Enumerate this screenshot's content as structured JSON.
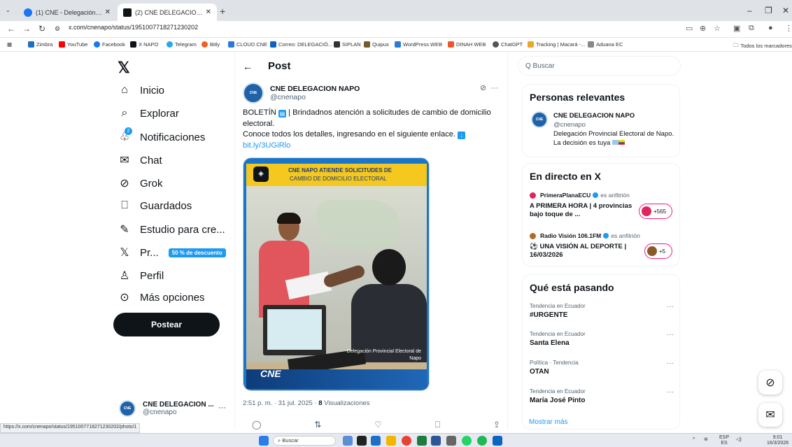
{
  "browser": {
    "tabs": [
      {
        "title": "(1) CNE - Delegación Provincial",
        "fav_color": "#1877f2"
      },
      {
        "title": "(2) CNE DELEGACION NAPO en",
        "fav_color": "#0f1419"
      }
    ],
    "url": "x.com/cnenapo/status/1951007718271230202",
    "bookmarks": [
      {
        "label": "Zimbra",
        "color": "#1f6fc5"
      },
      {
        "label": "YouTube",
        "color": "#ff0000"
      },
      {
        "label": "Facebook",
        "color": "#1877f2"
      },
      {
        "label": "X NAPO",
        "color": "#0f1419"
      },
      {
        "label": "Telegram",
        "color": "#27a7e7"
      },
      {
        "label": "Bitly",
        "color": "#ee6123"
      },
      {
        "label": "CLOUD CNE",
        "color": "#2a7ad8"
      },
      {
        "label": "Correo: DELEGACIÓ...",
        "color": "#0a64c2"
      },
      {
        "label": "SIPLAN",
        "color": "#333"
      },
      {
        "label": "Quipux",
        "color": "#7a5a2a"
      },
      {
        "label": "WordPress WEB",
        "color": "#2a7ad8"
      },
      {
        "label": "DINAH WEB",
        "color": "#e8582b"
      },
      {
        "label": "ChatGPT",
        "color": "#555"
      },
      {
        "label": "Tracking | Macará -...",
        "color": "#e8a92b"
      },
      {
        "label": "Aduana EC",
        "color": "#888"
      }
    ],
    "all_bookmarks": "Todos los marcadores"
  },
  "nav": {
    "items": [
      {
        "label": "Inicio",
        "icon": "⌂"
      },
      {
        "label": "Explorar",
        "icon": "⌕"
      },
      {
        "label": "Notificaciones",
        "icon": "🔔"
      },
      {
        "label": "Chat",
        "icon": "✉"
      },
      {
        "label": "Grok",
        "icon": "⊘"
      },
      {
        "label": "Guardados",
        "icon": "⎕"
      },
      {
        "label": "Estudio para cre...",
        "icon": "✎"
      },
      {
        "label": "Pr...",
        "icon": "𝕏"
      },
      {
        "label": "Perfil",
        "icon": "♙"
      },
      {
        "label": "Más opciones",
        "icon": "⊙"
      }
    ],
    "discount_badge": "50 % de descuento",
    "notif_count": "2",
    "post_button": "Postear"
  },
  "account": {
    "name": "CNE DELEGACION ...",
    "handle": "@cnenapo"
  },
  "post": {
    "header": "Post",
    "author_name": "CNE DELEGACION NAPO",
    "author_handle": "@cnenapo",
    "text_line1": "BOLETÍN",
    "text_line1_rest": "| Brindadnos atención a solicitudes de cambio de domicilio electoral.",
    "text_line2": "Conoce todos los detalles, ingresando en el siguiente enlace.",
    "link": "bit.ly/3UGiRlo",
    "media": {
      "banner_l1": "CNE NAPO ATIENDE SOLICITUDES DE",
      "banner_l2": "CAMBIO DE DOMICILIO ELECTORAL",
      "logo": "CNE",
      "footer_text": "Delegación Provincial Electoral de Napo"
    },
    "time": "2:51 p. m. · 31 jul. 2025 ·",
    "views_count": "8",
    "views_label": "Visualizaciones"
  },
  "sidebar": {
    "search_placeholder": "Q Buscar",
    "relevant": {
      "title": "Personas relevantes",
      "name": "CNE DELEGACION NAPO",
      "handle": "@cnenapo",
      "bio": "Delegación Provincial Electoral de Napo. La decisión es tuya"
    },
    "live": {
      "title": "En directo en X",
      "items": [
        {
          "host": "PrimeraPlanaECU",
          "suffix": "es anfitrión",
          "title": "A PRIMERA HORA | 4 provincias bajo toque de ...",
          "count": "+565",
          "dot": "#e0245e"
        },
        {
          "host": "Radio Visión 106.1FM",
          "suffix": "es anfitrión",
          "title": "⚽ UNA VISIÓN AL DEPORTE | 16/03/2026",
          "count": "+5",
          "dot": "#b36b2a"
        }
      ]
    },
    "trends": {
      "title": "Qué está pasando",
      "items": [
        {
          "context": "Tendencia en Ecuador",
          "name": "#URGENTE"
        },
        {
          "context": "Tendencia en Ecuador",
          "name": "Santa Elena"
        },
        {
          "context": "Política · Tendencia",
          "name": "OTAN"
        },
        {
          "context": "Tendencia en Ecuador",
          "name": "María José Pinto"
        }
      ],
      "show_more": "Mostrar más"
    }
  },
  "status_url": "https://x.com/cnenapo/status/1951007718271230202/photo/1",
  "taskbar": {
    "search": "Buscar",
    "lang1": "ESP",
    "lang2": "ES",
    "time": "9:01",
    "date": "16/3/2026"
  }
}
